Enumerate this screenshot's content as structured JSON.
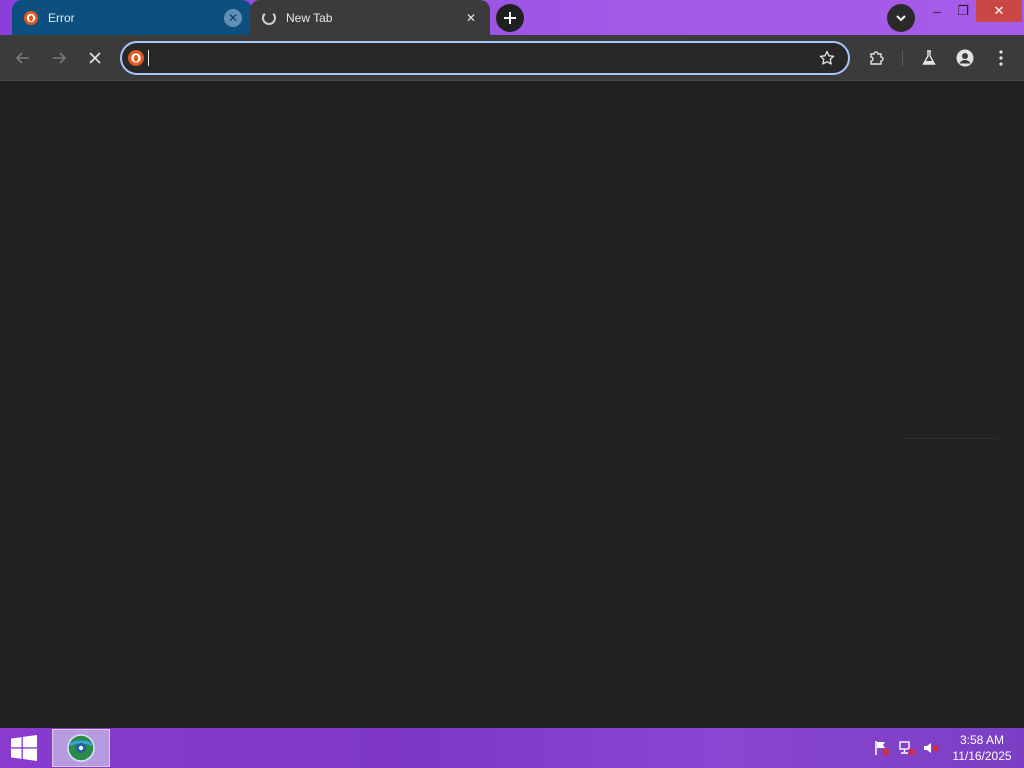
{
  "browser": {
    "tabs": [
      {
        "title": "Error",
        "active": false
      },
      {
        "title": "New Tab",
        "active": true,
        "loading": true
      }
    ],
    "new_tab_icon": "plus-icon",
    "tab_search_icon": "chevron-down-icon",
    "window_controls": {
      "minimize": "–",
      "restore": "❐",
      "close": "✕"
    },
    "nav": {
      "back": "←",
      "forward": "→",
      "stop": "✕"
    },
    "omnibox": {
      "value": "",
      "placeholder": ""
    },
    "toolbar_icons": [
      "bookmark-star-icon",
      "extensions-icon",
      "labs-flask-icon",
      "profile-icon",
      "menu-icon"
    ]
  },
  "taskbar": {
    "clock": {
      "time": "3:58 AM",
      "date": "11/16/2025"
    },
    "tray_icons": [
      "action-center-flag-icon",
      "network-icon",
      "volume-muted-icon"
    ]
  },
  "colors": {
    "titlebar_accent": "#a259e6",
    "active_tab": "#0d5080",
    "content_bg": "#222222",
    "taskbar": "#8a3bcf",
    "favicon": "#e2571e"
  }
}
